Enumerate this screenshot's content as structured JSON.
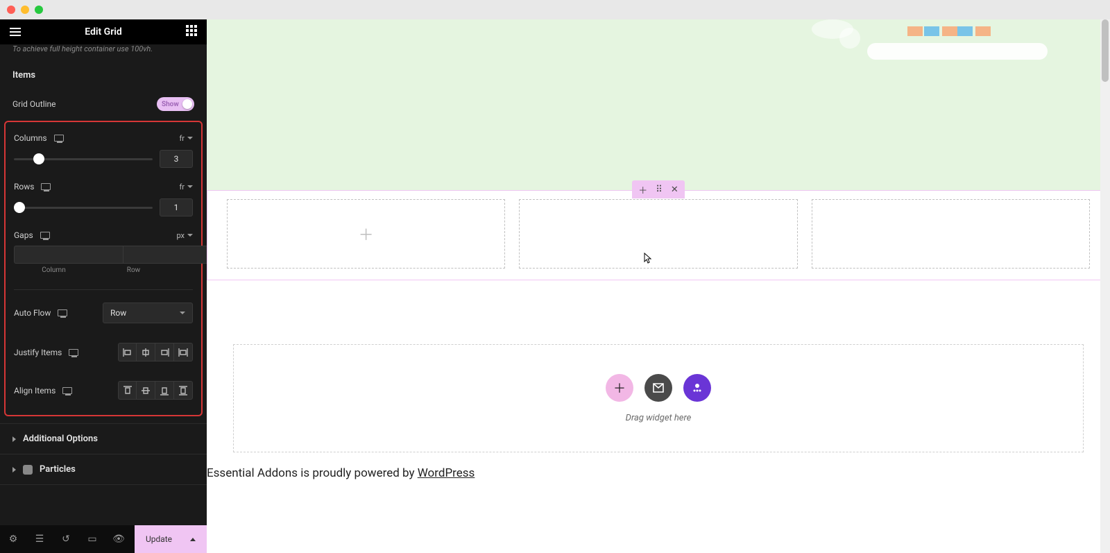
{
  "header": {
    "title": "Edit Grid"
  },
  "panel": {
    "hint": "To achieve full height container use 100vh.",
    "items_label": "Items",
    "grid_outline_label": "Grid Outline",
    "grid_outline_toggle": "Show",
    "columns": {
      "label": "Columns",
      "unit": "fr",
      "value": "3",
      "thumb_pos": "14%"
    },
    "rows": {
      "label": "Rows",
      "unit": "fr",
      "value": "1",
      "thumb_pos": "0%"
    },
    "gaps": {
      "label": "Gaps",
      "unit": "px",
      "col_label": "Column",
      "row_label": "Row",
      "col_val": "",
      "row_val": ""
    },
    "autoflow": {
      "label": "Auto Flow",
      "value": "Row"
    },
    "justify": {
      "label": "Justify Items"
    },
    "align": {
      "label": "Align Items"
    },
    "accordion1": "Additional Options",
    "accordion2": "Particles"
  },
  "footer": {
    "update": "Update"
  },
  "canvas": {
    "drag_text": "Drag widget here",
    "powered_prefix": "Essential Addons is proudly powered by ",
    "powered_link": "WordPress"
  },
  "icons": {
    "justify": [
      "⟸",
      "⇔",
      "⟹",
      "⟷"
    ],
    "align": [
      "⟰",
      "⇕",
      "⟱",
      "⟷"
    ]
  }
}
